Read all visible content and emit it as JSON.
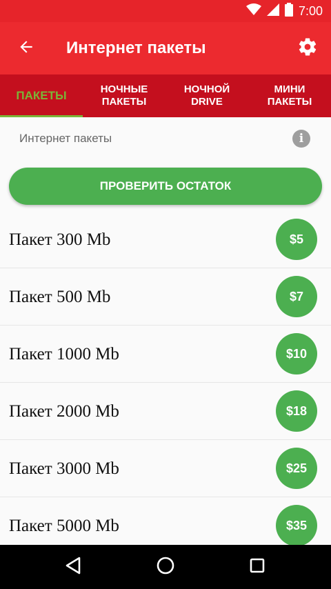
{
  "status_bar": {
    "time": "7:00"
  },
  "toolbar": {
    "title": "Интернет пакеты"
  },
  "tabs": [
    {
      "label": "ПАКЕТЫ",
      "active": true
    },
    {
      "label": "НОЧНЫЕ\nПАКЕТЫ",
      "active": false
    },
    {
      "label": "НОЧНОЙ\nDRIVE",
      "active": false
    },
    {
      "label": "МИНИ\nПАКЕТЫ",
      "active": false
    }
  ],
  "section": {
    "title": "Интернет пакеты",
    "info_glyph": "i"
  },
  "check_button": {
    "label": "ПРОВЕРИТЬ ОСТАТОК"
  },
  "packages": [
    {
      "name": "Пакет 300 Mb",
      "price": "$5"
    },
    {
      "name": "Пакет 500 Mb",
      "price": "$7"
    },
    {
      "name": "Пакет 1000 Mb",
      "price": "$10"
    },
    {
      "name": "Пакет 2000 Mb",
      "price": "$18"
    },
    {
      "name": "Пакет 3000 Mb",
      "price": "$25"
    },
    {
      "name": "Пакет 5000 Mb",
      "price": "$35"
    }
  ],
  "colors": {
    "status_bar": "#e6242a",
    "toolbar": "#ec2a2f",
    "tabs": "#c40f1e",
    "active_tab": "#7bb437",
    "accent_green": "#4caf50"
  },
  "icons": {
    "back": "arrow-back-icon",
    "settings": "gear-icon",
    "info": "info-icon",
    "wifi": "wifi-icon",
    "signal": "signal-icon",
    "battery": "battery-icon",
    "nav_back": "nav-back-icon",
    "nav_home": "nav-home-icon",
    "nav_recents": "nav-recents-icon"
  }
}
